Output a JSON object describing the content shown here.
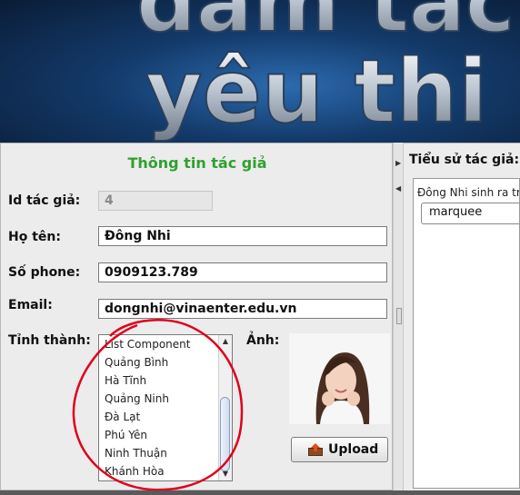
{
  "banner": {
    "text_line1": "đam tác",
    "text_line2": "yêu thi"
  },
  "form": {
    "title": "Thông tin tác giả",
    "id_label": "Id tác giả:",
    "id_value": "4",
    "name_label": "Họ tên:",
    "name_value": "Đông Nhi",
    "phone_label": "Số phone:",
    "phone_value": "0909123.789",
    "email_label": "Email:",
    "email_value": "dongnhi@vinaenter.edu.vn",
    "city_label": "Tỉnh thành:",
    "photo_label": "Ảnh:",
    "upload_label": "Upload"
  },
  "city_list": [
    "List Component",
    "Quảng Bình",
    "Hà Tĩnh",
    "Quảng Ninh",
    "Đà Lạt",
    "Phú Yên",
    "Ninh Thuận",
    "Khánh Hòa"
  ],
  "bio": {
    "label": "Tiểu sử tác giả:",
    "text": "Đông Nhi sinh ra trong",
    "marquee_text": "marquee"
  },
  "colors": {
    "title": "#2ea12e",
    "annotation": "#e0001b"
  }
}
